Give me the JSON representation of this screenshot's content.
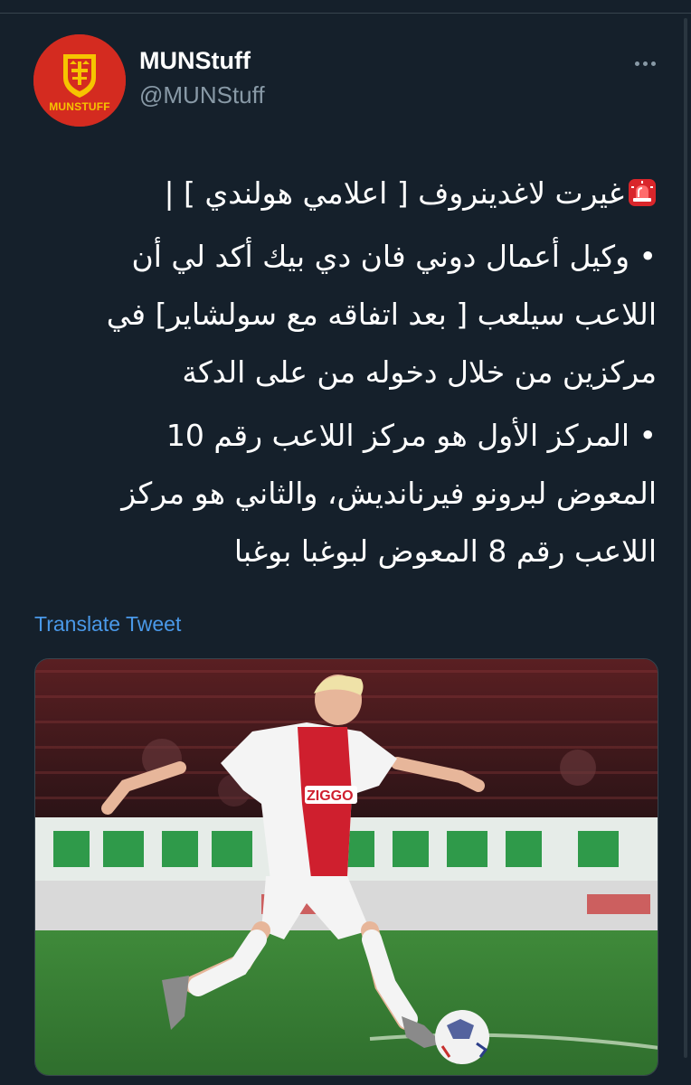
{
  "tweet": {
    "author_name": "MUNStuff",
    "author_handle": "@MUNStuff",
    "avatar_text": "MUNSTUFF",
    "more_icon": "more-horizontal-icon",
    "body": {
      "line1": "غيرت لاغدينروف [ اعلامي هولندي ] |",
      "line1_icon": "siren-emoji",
      "p2_line1": "• وكيل أعمال دوني فان دي بيك أكد لي أن",
      "p2_line2": "اللاعب سيلعب [ بعد اتفاقه مع سولشاير]  في",
      "p2_line3": "مركزين من خلال دخوله من على الدكة",
      "p3_line1": "• المركز الأول هو مركز اللاعب رقم 10",
      "p3_line2": "المعوض لبرونو فيرنانديش، والثاني هو مركز",
      "p3_line3": "اللاعب رقم 8 المعوض لبوغبا بوغبا"
    },
    "translate_label": "Translate Tweet",
    "media": {
      "description_icon": "football-photo",
      "sponsor_text": "ZIGGO"
    }
  },
  "colors": {
    "background": "#15202b",
    "text": "#ffffff",
    "secondary": "#8899a6",
    "link": "#4a99e9",
    "avatar_bg": "#d42b20",
    "avatar_gold": "#f6c400"
  }
}
